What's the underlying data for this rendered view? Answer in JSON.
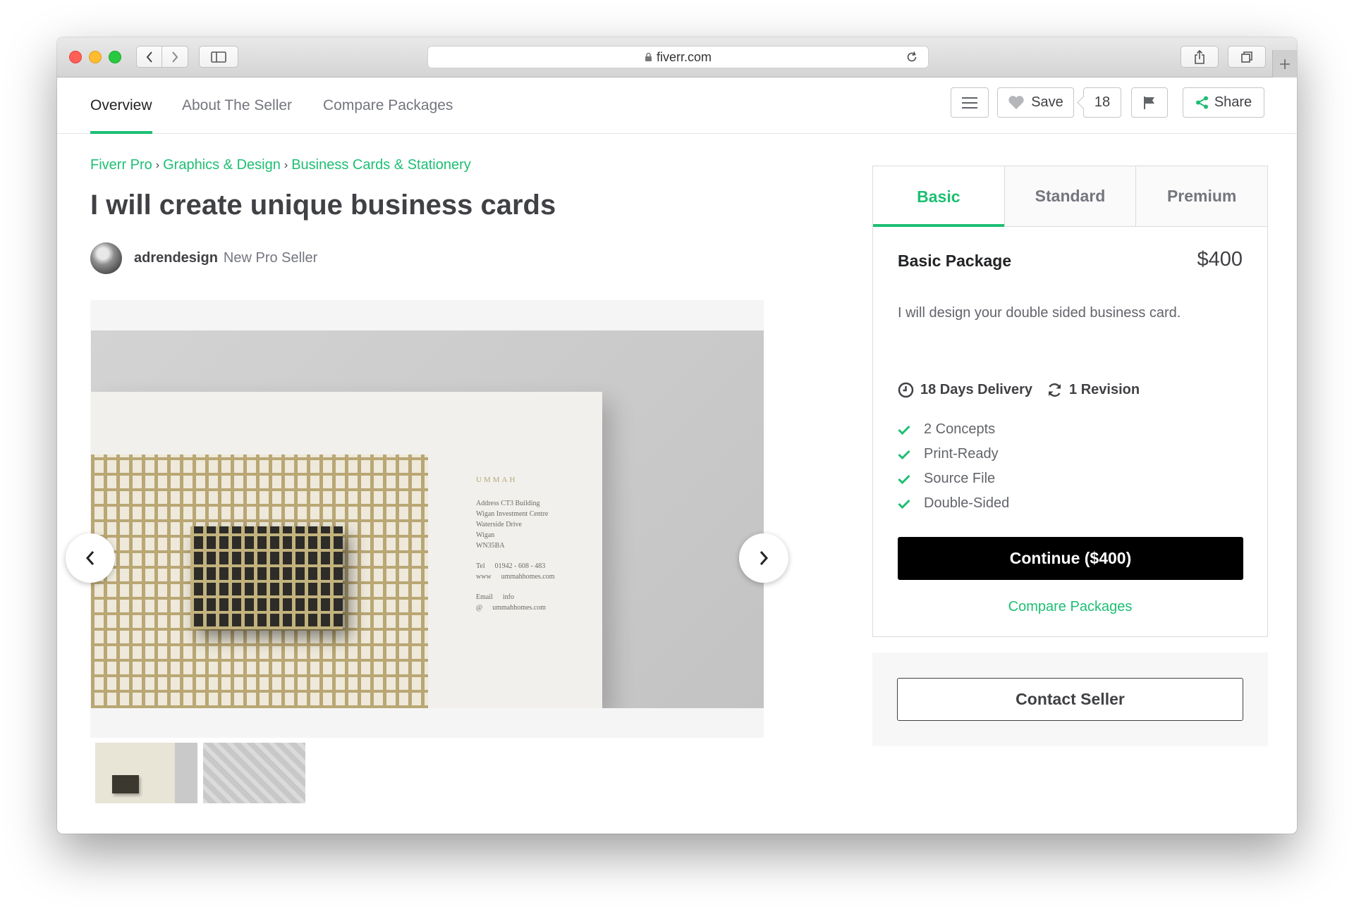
{
  "browser": {
    "url": "fiverr.com"
  },
  "nav": {
    "tabs": [
      "Overview",
      "About The Seller",
      "Compare Packages"
    ],
    "save_label": "Save",
    "save_count": "18",
    "share_label": "Share"
  },
  "breadcrumb": [
    "Fiverr Pro",
    "Graphics & Design",
    "Business Cards & Stationery"
  ],
  "gig": {
    "title": "I will create unique business cards",
    "seller_name": "adrendesign",
    "seller_level": "New Pro Seller"
  },
  "gallery_text": {
    "brand": "UMMAH",
    "address_lines": [
      "Address CT3 Building",
      "Wigan Investment Centre",
      "Waterside Drive",
      "Wigan",
      "WN35BA"
    ],
    "tel_label": "Tel",
    "tel_value": "01942 - 608 - 483",
    "www_label": "www",
    "www_value": "ummahhomes.com",
    "email_label": "Email",
    "email_value": "info",
    "at_label": "@",
    "at_value": "ummahhomes.com"
  },
  "packages": {
    "tabs": [
      "Basic",
      "Standard",
      "Premium"
    ],
    "name": "Basic Package",
    "price": "$400",
    "description": "I will design your double sided business card.",
    "delivery": "18 Days Delivery",
    "revisions": "1 Revision",
    "features": [
      "2 Concepts",
      "Print-Ready",
      "Source File",
      "Double-Sided"
    ],
    "continue_label": "Continue ($400)",
    "compare_label": "Compare Packages"
  },
  "contact_label": "Contact Seller",
  "colors": {
    "accent": "#1dbf73",
    "text": "#404145"
  }
}
